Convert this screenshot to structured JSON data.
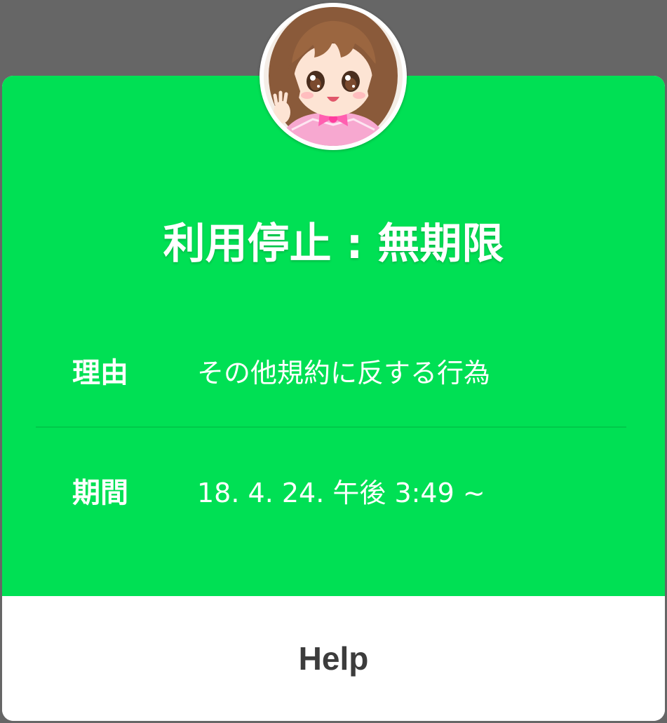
{
  "dialog": {
    "title": "利用停止 : 無期限",
    "rows": [
      {
        "label": "理由",
        "value": "その他規約に反する行為"
      },
      {
        "label": "期間",
        "value": "18. 4. 24. 午後 3:49 ~"
      }
    ],
    "help_label": "Help",
    "avatar_icon": "girl-character-avatar-icon"
  },
  "colors": {
    "accent": "#00e054",
    "overlay": "#666666",
    "text_on_accent": "#ffffff",
    "button_text": "#3c3c3c"
  }
}
